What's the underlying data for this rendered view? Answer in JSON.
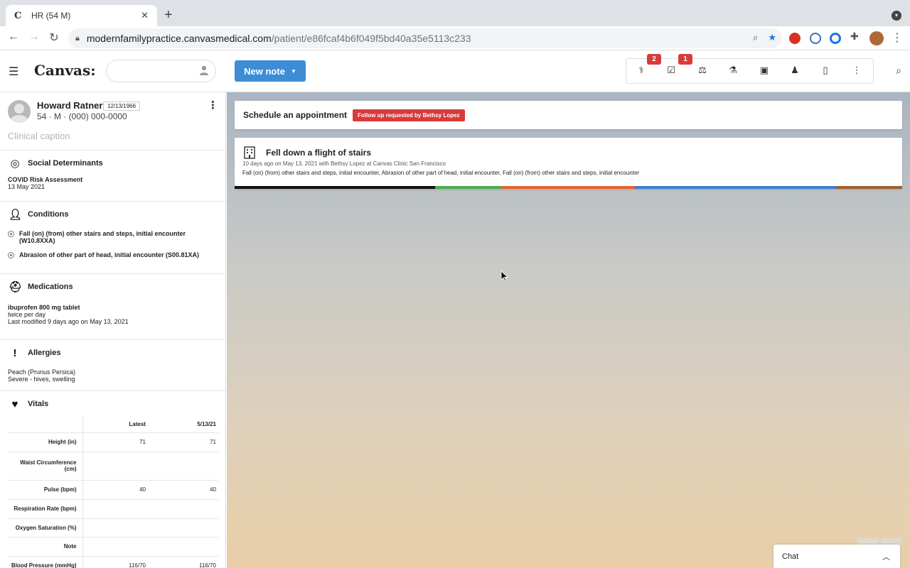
{
  "browser": {
    "tab_title": "HR (54 M)",
    "favicon": "C",
    "close_glyph": "✕",
    "newtab_glyph": "+",
    "url_host": "modernfamilypractice.canvasmedical.com",
    "url_path": "/patient/e86fcaf4b6f049f5bd40a35e5113c233"
  },
  "header": {
    "logo": "Canvas:",
    "search_value": "",
    "new_note_label": "New note",
    "badges": {
      "first": "2",
      "second": "1"
    }
  },
  "patient": {
    "name": "Howard Ratner",
    "dob": "12/13/1966",
    "meta": "54 · M · (000) 000-0000",
    "caption": "Clinical caption"
  },
  "sections": {
    "social": {
      "title": "Social Determinants",
      "item_name": "COVID Risk Assessment",
      "item_date": "13 May 2021"
    },
    "conditions": {
      "title": "Conditions",
      "items": [
        "Fall (on) (from) other stairs and steps, initial encounter (W10.8XXA)",
        "Abrasion of other part of head, initial encounter (S00.81XA)"
      ]
    },
    "medications": {
      "title": "Medications",
      "name": "ibuprofen 800 mg tablet",
      "frequency": "twice per day",
      "modified": "Last modified 9 days ago on May 13, 2021"
    },
    "allergies": {
      "title": "Allergies",
      "name": "Peach (Prunus Persica)",
      "reaction": "Severe - hives, swelling"
    },
    "vitals": {
      "title": "Vitals",
      "col_latest": "Latest",
      "col_date": "5/13/21",
      "rows": [
        {
          "label": "Height (in)",
          "latest": "71",
          "date": "71"
        },
        {
          "label": "Waist Circumference (cm)",
          "latest": "",
          "date": ""
        },
        {
          "label": "Pulse (bpm)",
          "latest": "40",
          "date": "40"
        },
        {
          "label": "Respiration Rate (bpm)",
          "latest": "",
          "date": ""
        },
        {
          "label": "Oxygen Saturation (%)",
          "latest": "",
          "date": ""
        },
        {
          "label": "Note",
          "latest": "",
          "date": ""
        },
        {
          "label": "Blood Pressure (mmHg)",
          "latest": "116/70",
          "date": "116/70"
        }
      ]
    }
  },
  "main": {
    "appointment": {
      "title": "Schedule an appointment",
      "badge": "Follow up requested by Bethsy Lopez"
    },
    "note": {
      "title": "Fell down a flight of stairs",
      "subtitle": "10 days ago on May 13, 2021 with Bethsy Lopez at Canvas Clinic San Francisco",
      "description": "Fall (on) (from) other stairs and steps, initial encounter, Abrasion of other part of head, initial encounter, Fall (on) (from) other stairs and steps, initial encounter"
    }
  },
  "chat": {
    "label": "Chat"
  },
  "colors": {
    "primary": "#3b8ed6",
    "badge_red": "#d83a3a",
    "bar_black": "#111111",
    "bar_green": "#4caf50",
    "bar_orange": "#e8602c",
    "bar_blue": "#3b7fd1",
    "bar_brown": "#a0612f"
  },
  "icons": {
    "toolbar": [
      "caduceus-icon",
      "checkbox-icon",
      "scale-icon",
      "flask-icon",
      "image-icon",
      "doctor-icon",
      "document-icon",
      "more-vertical-icon"
    ]
  }
}
